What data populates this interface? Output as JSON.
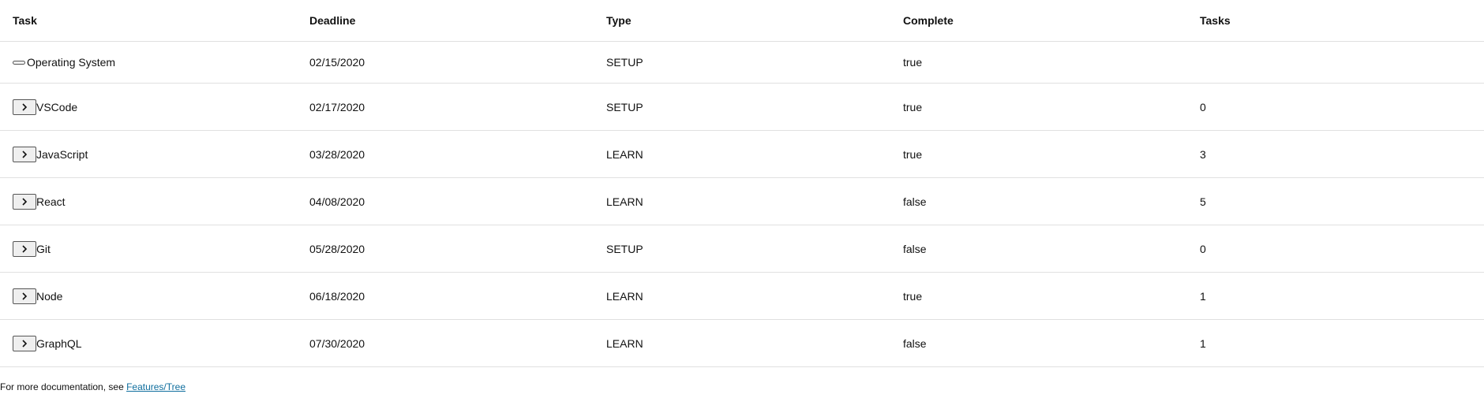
{
  "columns": {
    "task": "Task",
    "deadline": "Deadline",
    "type": "Type",
    "complete": "Complete",
    "tasks": "Tasks"
  },
  "rows": [
    {
      "task": "Operating System",
      "deadline": "02/15/2020",
      "type": "SETUP",
      "complete": "true",
      "tasks": ""
    },
    {
      "task": "VSCode",
      "deadline": "02/17/2020",
      "type": "SETUP",
      "complete": "true",
      "tasks": "0"
    },
    {
      "task": "JavaScript",
      "deadline": "03/28/2020",
      "type": "LEARN",
      "complete": "true",
      "tasks": "3"
    },
    {
      "task": "React",
      "deadline": "04/08/2020",
      "type": "LEARN",
      "complete": "false",
      "tasks": "5"
    },
    {
      "task": "Git",
      "deadline": "05/28/2020",
      "type": "SETUP",
      "complete": "false",
      "tasks": "0"
    },
    {
      "task": "Node",
      "deadline": "06/18/2020",
      "type": "LEARN",
      "complete": "true",
      "tasks": "1"
    },
    {
      "task": "GraphQL",
      "deadline": "07/30/2020",
      "type": "LEARN",
      "complete": "false",
      "tasks": "1"
    }
  ],
  "icons": {
    "expander": "chevron-right-icon",
    "collapsed": "collapsed-bar-icon"
  },
  "footer": {
    "text": "For more documentation, see ",
    "link_label": "Features/Tree"
  },
  "colors": {
    "link": "#0f6e9e",
    "border": "#e0e0e0"
  }
}
